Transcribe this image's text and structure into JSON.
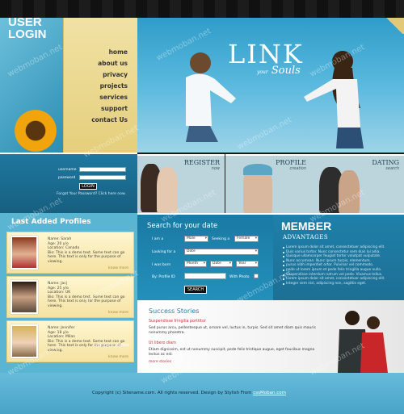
{
  "nav": {
    "items": [
      "home",
      "about us",
      "privacy",
      "projects",
      "services",
      "support",
      "contact Us"
    ]
  },
  "hero": {
    "title": "LINK",
    "subtitle": "Souls",
    "pre": "your"
  },
  "login": {
    "title_line1": "USER",
    "title_line2": "LOGIN",
    "username_label": "username",
    "password_label": "password",
    "button": "LOGIN",
    "forgot": "Forgot Your Password? Click here now."
  },
  "features": [
    {
      "title": "REGISTER",
      "sub": "now"
    },
    {
      "title": "PROFILE",
      "sub": "creation"
    },
    {
      "title": "DATING",
      "sub": "search"
    }
  ],
  "profiles": {
    "title": "Last Added Profiles",
    "items": [
      {
        "name": "Name: Sarah",
        "age": "Age: 20 y/o",
        "location": "Location: Canada",
        "bio": "Bio: This is a demo text. Some text can go here. This text is only for the purpose of viewing.",
        "more": "know more"
      },
      {
        "name": "Name: Jac|",
        "age": "Age: 25 y/o",
        "location": "Location: UK",
        "bio": "Bio: This is a demo text. Some text can go here. This text is only for the purpose of viewing.",
        "more": "know more"
      },
      {
        "name": "Name: Jennifer",
        "age": "Age: 18 y/o",
        "location": "Location: Milan",
        "bio": "Bio: This is a demo text. Some text can go here. This text is only for the purpose of viewing.",
        "more": "know more"
      }
    ],
    "find_more": "find more profiles"
  },
  "search": {
    "title": "Search for your date",
    "i_am_label": "I am a",
    "i_am_value": "Male",
    "seeking_label": "Seeking a",
    "seeking_value": "Female",
    "looking_label": "Looking for a",
    "looking_value": "Date",
    "born_label": "I was born",
    "month": "Month",
    "day": "Date",
    "year": "Year",
    "profile_id_label": "By: Profile ID",
    "with_photo_label": "With Photo",
    "button": "SEARCH"
  },
  "member": {
    "title": "MEMBER",
    "sub": "ADVANTAGES",
    "items": [
      "Lorem ipsum dolor sit amet, consectetuer adipiscing elit.",
      "Duis varius tortor. Nunc consectetur sem duis lui adia.",
      "Quisque ullamcorper feugiat tortor volutpat vulputate.",
      "Nunc accumsan. Nunc ipsum turpis, elementum.",
      "purus nibh imperdiet ortor. Pulvinar vel commodo.",
      "pede ut lorem ipsum et pede felis tringilla augue nulla.",
      "Suspendisse interdum rutrum vel pede. Vivamus tellus.",
      "Lorem ipsum dolor sit amet, consectetuer adipiscing elit.",
      "Integer sem nisl, adipiscing non, sagittis eget."
    ]
  },
  "stories": {
    "title": "Success Stories",
    "s1_head": "Suspendisse fringilla porttitor",
    "s1_body": "Sed purus arcu, pellentesque ut, ornare vel, luctus in, turpis. Sed sit amet diam quis mauris nonummy pharetra.",
    "s2_head": "Ut libero diam",
    "s2_body": "Etiam dignissim, est ut nonummy suscipit, pede felis tristique augue, eget faucibus magna lectus ac est.",
    "more": "more stories"
  },
  "footer": {
    "text": "Copyright (c) Sitename.com. All rights reserved. Design by Stylish From ",
    "link": "cssMoban.com"
  },
  "watermark": "webmoban.net",
  "colors": {
    "accent": "#2390bb",
    "panel": "#f1e2a5",
    "dark": "#1a7aa3"
  }
}
